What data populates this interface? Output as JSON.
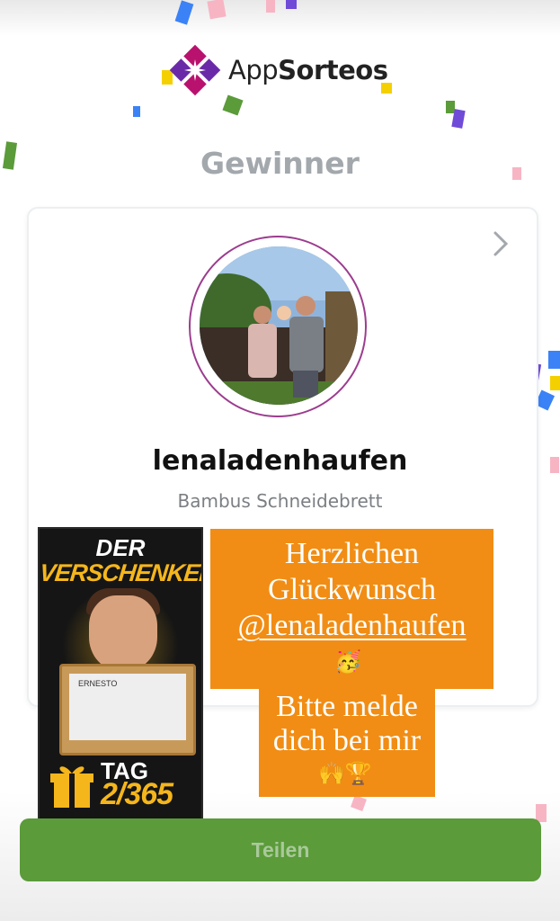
{
  "app": {
    "logo_text_regular": "App",
    "logo_text_bold": "Sorteos"
  },
  "heading": "Gewinner",
  "winner": {
    "username": "lenaladenhaufen",
    "prize": "Bambus Schneidebrett"
  },
  "poster": {
    "line1": "DER",
    "line2": "VERSCHENKER",
    "brand": "ERNESTO",
    "tag": "TAG",
    "day": "2/365"
  },
  "sticker": {
    "line1": "Herzlichen",
    "line2": "Glückwunsch",
    "mention": "@lenaladenhaufen",
    "emoji_party": "🥳",
    "line3": "Bitte melde",
    "line4": "dich bei mir",
    "emoji_end": "🙌🏆"
  },
  "share_button": {
    "label": "Teilen"
  },
  "colors": {
    "accent_green": "#5b9b3a",
    "sticker_orange": "#f18d14",
    "avatar_ring": "#9c3c8e",
    "brand_magenta": "#b8126e",
    "brand_purple": "#6a2aa8"
  }
}
